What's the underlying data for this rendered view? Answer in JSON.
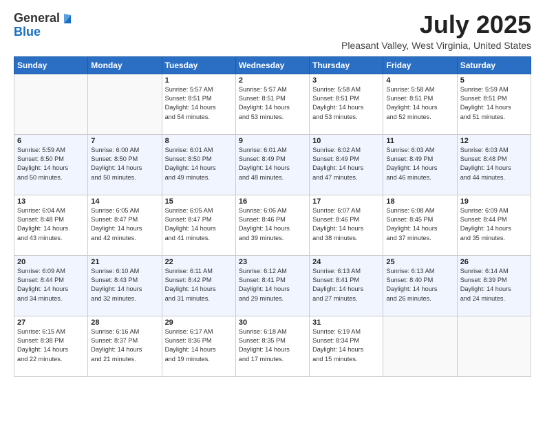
{
  "logo": {
    "line1": "General",
    "line2": "Blue"
  },
  "title": "July 2025",
  "location": "Pleasant Valley, West Virginia, United States",
  "weekdays": [
    "Sunday",
    "Monday",
    "Tuesday",
    "Wednesday",
    "Thursday",
    "Friday",
    "Saturday"
  ],
  "weeks": [
    [
      {
        "day": "",
        "info": ""
      },
      {
        "day": "",
        "info": ""
      },
      {
        "day": "1",
        "info": "Sunrise: 5:57 AM\nSunset: 8:51 PM\nDaylight: 14 hours\nand 54 minutes."
      },
      {
        "day": "2",
        "info": "Sunrise: 5:57 AM\nSunset: 8:51 PM\nDaylight: 14 hours\nand 53 minutes."
      },
      {
        "day": "3",
        "info": "Sunrise: 5:58 AM\nSunset: 8:51 PM\nDaylight: 14 hours\nand 53 minutes."
      },
      {
        "day": "4",
        "info": "Sunrise: 5:58 AM\nSunset: 8:51 PM\nDaylight: 14 hours\nand 52 minutes."
      },
      {
        "day": "5",
        "info": "Sunrise: 5:59 AM\nSunset: 8:51 PM\nDaylight: 14 hours\nand 51 minutes."
      }
    ],
    [
      {
        "day": "6",
        "info": "Sunrise: 5:59 AM\nSunset: 8:50 PM\nDaylight: 14 hours\nand 50 minutes."
      },
      {
        "day": "7",
        "info": "Sunrise: 6:00 AM\nSunset: 8:50 PM\nDaylight: 14 hours\nand 50 minutes."
      },
      {
        "day": "8",
        "info": "Sunrise: 6:01 AM\nSunset: 8:50 PM\nDaylight: 14 hours\nand 49 minutes."
      },
      {
        "day": "9",
        "info": "Sunrise: 6:01 AM\nSunset: 8:49 PM\nDaylight: 14 hours\nand 48 minutes."
      },
      {
        "day": "10",
        "info": "Sunrise: 6:02 AM\nSunset: 8:49 PM\nDaylight: 14 hours\nand 47 minutes."
      },
      {
        "day": "11",
        "info": "Sunrise: 6:03 AM\nSunset: 8:49 PM\nDaylight: 14 hours\nand 46 minutes."
      },
      {
        "day": "12",
        "info": "Sunrise: 6:03 AM\nSunset: 8:48 PM\nDaylight: 14 hours\nand 44 minutes."
      }
    ],
    [
      {
        "day": "13",
        "info": "Sunrise: 6:04 AM\nSunset: 8:48 PM\nDaylight: 14 hours\nand 43 minutes."
      },
      {
        "day": "14",
        "info": "Sunrise: 6:05 AM\nSunset: 8:47 PM\nDaylight: 14 hours\nand 42 minutes."
      },
      {
        "day": "15",
        "info": "Sunrise: 6:05 AM\nSunset: 8:47 PM\nDaylight: 14 hours\nand 41 minutes."
      },
      {
        "day": "16",
        "info": "Sunrise: 6:06 AM\nSunset: 8:46 PM\nDaylight: 14 hours\nand 39 minutes."
      },
      {
        "day": "17",
        "info": "Sunrise: 6:07 AM\nSunset: 8:46 PM\nDaylight: 14 hours\nand 38 minutes."
      },
      {
        "day": "18",
        "info": "Sunrise: 6:08 AM\nSunset: 8:45 PM\nDaylight: 14 hours\nand 37 minutes."
      },
      {
        "day": "19",
        "info": "Sunrise: 6:09 AM\nSunset: 8:44 PM\nDaylight: 14 hours\nand 35 minutes."
      }
    ],
    [
      {
        "day": "20",
        "info": "Sunrise: 6:09 AM\nSunset: 8:44 PM\nDaylight: 14 hours\nand 34 minutes."
      },
      {
        "day": "21",
        "info": "Sunrise: 6:10 AM\nSunset: 8:43 PM\nDaylight: 14 hours\nand 32 minutes."
      },
      {
        "day": "22",
        "info": "Sunrise: 6:11 AM\nSunset: 8:42 PM\nDaylight: 14 hours\nand 31 minutes."
      },
      {
        "day": "23",
        "info": "Sunrise: 6:12 AM\nSunset: 8:41 PM\nDaylight: 14 hours\nand 29 minutes."
      },
      {
        "day": "24",
        "info": "Sunrise: 6:13 AM\nSunset: 8:41 PM\nDaylight: 14 hours\nand 27 minutes."
      },
      {
        "day": "25",
        "info": "Sunrise: 6:13 AM\nSunset: 8:40 PM\nDaylight: 14 hours\nand 26 minutes."
      },
      {
        "day": "26",
        "info": "Sunrise: 6:14 AM\nSunset: 8:39 PM\nDaylight: 14 hours\nand 24 minutes."
      }
    ],
    [
      {
        "day": "27",
        "info": "Sunrise: 6:15 AM\nSunset: 8:38 PM\nDaylight: 14 hours\nand 22 minutes."
      },
      {
        "day": "28",
        "info": "Sunrise: 6:16 AM\nSunset: 8:37 PM\nDaylight: 14 hours\nand 21 minutes."
      },
      {
        "day": "29",
        "info": "Sunrise: 6:17 AM\nSunset: 8:36 PM\nDaylight: 14 hours\nand 19 minutes."
      },
      {
        "day": "30",
        "info": "Sunrise: 6:18 AM\nSunset: 8:35 PM\nDaylight: 14 hours\nand 17 minutes."
      },
      {
        "day": "31",
        "info": "Sunrise: 6:19 AM\nSunset: 8:34 PM\nDaylight: 14 hours\nand 15 minutes."
      },
      {
        "day": "",
        "info": ""
      },
      {
        "day": "",
        "info": ""
      }
    ]
  ]
}
